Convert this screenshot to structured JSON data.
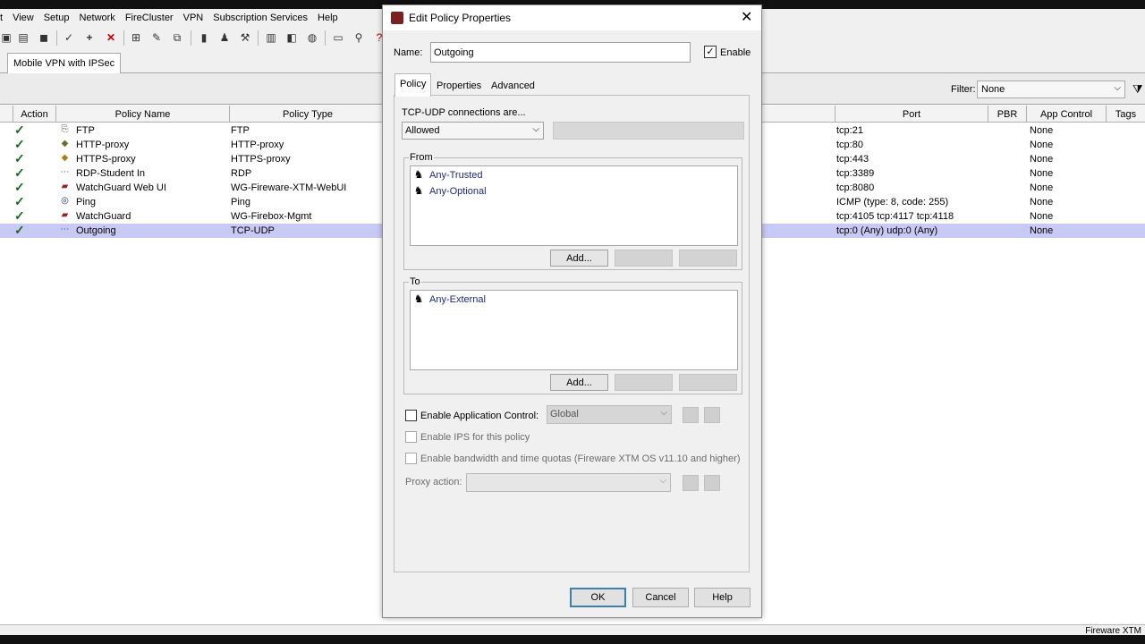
{
  "menu": [
    "t",
    "View",
    "Setup",
    "Network",
    "FireCluster",
    "VPN",
    "Subscription Services",
    "Help"
  ],
  "toolbar": {
    "icons": [
      "save-icon",
      "open-icon",
      "floppy-icon",
      "wizard-icon",
      "add-icon",
      "delete-icon",
      "network-icon",
      "edit-icon",
      "copy-icon",
      "clipboard-icon",
      "user-icon",
      "tools-icon",
      "document-icon",
      "report-icon",
      "monitor-icon",
      "screen-icon",
      "search-icon",
      "help-icon"
    ]
  },
  "tabs": {
    "active": "Mobile VPN with IPSec"
  },
  "filter": {
    "label": "Filter:",
    "value": "None"
  },
  "table": {
    "columns": [
      "Action",
      "Policy Name",
      "Policy Type",
      "Port",
      "PBR",
      "App Control",
      "Tags"
    ],
    "rows": [
      {
        "name": "FTP",
        "type": "FTP",
        "port": "tcp:21",
        "app": "None",
        "icon": "ftp-icon"
      },
      {
        "name": "HTTP-proxy",
        "type": "HTTP-proxy",
        "port": "tcp:80",
        "app": "None",
        "icon": "shield-icon"
      },
      {
        "name": "HTTPS-proxy",
        "type": "HTTPS-proxy",
        "port": "tcp:443",
        "app": "None",
        "icon": "shield-lock-icon"
      },
      {
        "name": "RDP-Student In",
        "type": "RDP",
        "port": "tcp:3389",
        "app": "None",
        "icon": "dotted-line-icon"
      },
      {
        "name": "WatchGuard Web UI",
        "type": "WG-Fireware-XTM-WebUI",
        "port": "tcp:8080",
        "app": "None",
        "icon": "firebox-icon"
      },
      {
        "name": "Ping",
        "type": "Ping",
        "port": "ICMP (type: 8, code: 255)",
        "app": "None",
        "icon": "ping-icon"
      },
      {
        "name": "WatchGuard",
        "type": "WG-Firebox-Mgmt",
        "port": "tcp:4105 tcp:4117 tcp:4118",
        "app": "None",
        "icon": "firebox-icon"
      },
      {
        "name": "Outgoing",
        "type": "TCP-UDP",
        "port": "tcp:0 (Any) udp:0 (Any)",
        "app": "None",
        "icon": "dotted-line-icon"
      }
    ]
  },
  "statusbar": {
    "text": "Fireware XTM"
  },
  "dialog": {
    "title": "Edit Policy Properties",
    "name_label": "Name:",
    "name_value": "Outgoing",
    "enable_label": "Enable",
    "enable_checked": true,
    "tabs": [
      "Policy",
      "Properties",
      "Advanced"
    ],
    "active_tab": "Policy",
    "connections_label": "TCP-UDP connections are...",
    "connections_value": "Allowed",
    "from": {
      "label": "From",
      "items": [
        "Any-Trusted",
        "Any-Optional"
      ],
      "add": "Add..."
    },
    "to": {
      "label": "To",
      "items": [
        "Any-External"
      ],
      "add": "Add..."
    },
    "app_control": {
      "label": "Enable Application Control:",
      "value": "Global",
      "checked": false
    },
    "ips": {
      "label": "Enable IPS for this policy",
      "checked": false
    },
    "quota": {
      "label": "Enable bandwidth and time quotas (Fireware XTM OS v11.10 and higher)",
      "checked": false
    },
    "proxy_action": {
      "label": "Proxy action:"
    },
    "buttons": {
      "ok": "OK",
      "cancel": "Cancel",
      "help": "Help"
    }
  }
}
